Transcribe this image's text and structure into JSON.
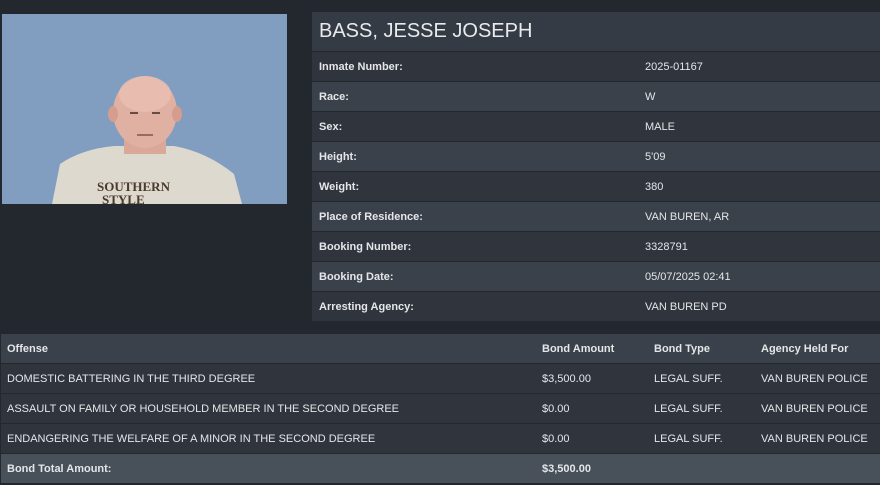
{
  "inmate": {
    "name": "BASS, JESSE JOSEPH",
    "shirt_text": "SOUTHERN STYLE",
    "fields": [
      {
        "label": "Inmate Number:",
        "value": "2025-01167"
      },
      {
        "label": "Race:",
        "value": "W"
      },
      {
        "label": "Sex:",
        "value": "MALE"
      },
      {
        "label": "Height:",
        "value": "5'09"
      },
      {
        "label": "Weight:",
        "value": "380"
      },
      {
        "label": "Place of Residence:",
        "value": "VAN BUREN, AR"
      },
      {
        "label": "Booking Number:",
        "value": "3328791"
      },
      {
        "label": "Booking Date:",
        "value": "05/07/2025 02:41"
      },
      {
        "label": "Arresting Agency:",
        "value": "VAN BUREN PD"
      }
    ]
  },
  "offenses": {
    "headers": {
      "offense": "Offense",
      "bond_amount": "Bond Amount",
      "bond_type": "Bond Type",
      "agency": "Agency Held For"
    },
    "rows": [
      {
        "offense": "DOMESTIC BATTERING IN THE THIRD DEGREE",
        "bond_amount": "$3,500.00",
        "bond_type": "LEGAL SUFF.",
        "agency": "VAN BUREN POLICE"
      },
      {
        "offense": "ASSAULT ON FAMILY OR HOUSEHOLD MEMBER IN THE SECOND DEGREE",
        "bond_amount": "$0.00",
        "bond_type": "LEGAL SUFF.",
        "agency": "VAN BUREN POLICE"
      },
      {
        "offense": "ENDANGERING THE WELFARE OF A MINOR IN THE SECOND DEGREE",
        "bond_amount": "$0.00",
        "bond_type": "LEGAL SUFF.",
        "agency": "VAN BUREN POLICE"
      }
    ],
    "total_label": "Bond Total Amount:",
    "total_value": "$3,500.00"
  }
}
